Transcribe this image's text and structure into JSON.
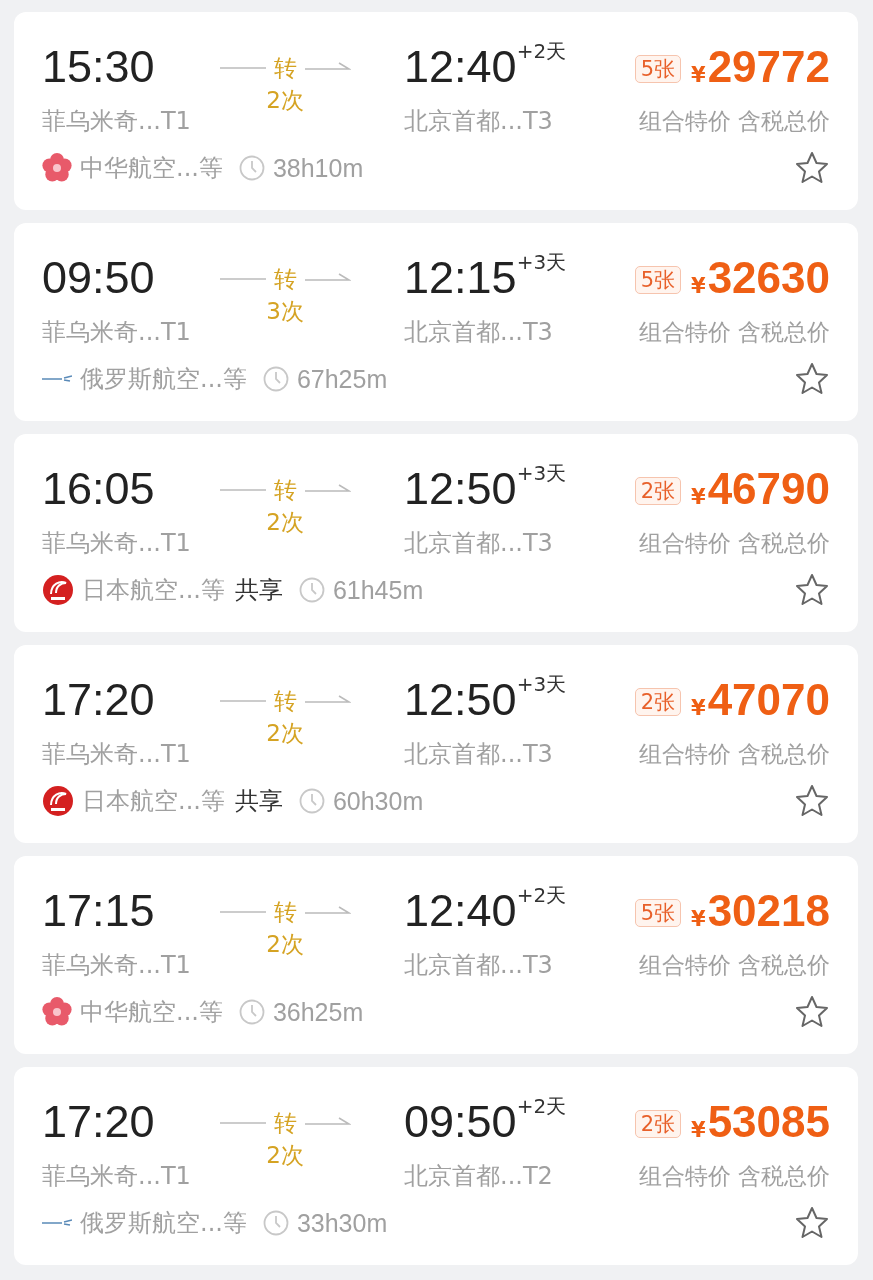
{
  "flights": [
    {
      "depart_time": "15:30",
      "depart_airport": "菲乌米奇...T1",
      "transfer": "转",
      "stops": "2次",
      "arrive_time": "12:40",
      "day_offset": "+2天",
      "arrive_airport": "北京首都...T3",
      "tickets": "5张",
      "currency": "¥",
      "price": "29772",
      "price_note": "组合特价 含税总价",
      "logo": {
        "kind": "plum"
      },
      "airline": "中华航空...等",
      "duration": "38h10m",
      "favorite": false
    },
    {
      "depart_time": "09:50",
      "depart_airport": "菲乌米奇...T1",
      "transfer": "转",
      "stops": "3次",
      "arrive_time": "12:15",
      "day_offset": "+3天",
      "arrive_airport": "北京首都...T3",
      "tickets": "5张",
      "currency": "¥",
      "price": "32630",
      "price_note": "组合特价 含税总价",
      "logo": {
        "kind": "wing"
      },
      "airline": "俄罗斯航空...等",
      "duration": "67h25m",
      "favorite": false
    },
    {
      "depart_time": "16:05",
      "depart_airport": "菲乌米奇...T1",
      "transfer": "转",
      "stops": "2次",
      "arrive_time": "12:50",
      "day_offset": "+3天",
      "arrive_airport": "北京首都...T3",
      "tickets": "2张",
      "currency": "¥",
      "price": "46790",
      "price_note": "组合特价 含税总价",
      "logo": {
        "kind": "crane"
      },
      "airline": "日本航空...等",
      "codeshare": "共享",
      "duration": "61h45m",
      "favorite": false
    },
    {
      "depart_time": "17:20",
      "depart_airport": "菲乌米奇...T1",
      "transfer": "转",
      "stops": "2次",
      "arrive_time": "12:50",
      "day_offset": "+3天",
      "arrive_airport": "北京首都...T3",
      "tickets": "2张",
      "currency": "¥",
      "price": "47070",
      "price_note": "组合特价 含税总价",
      "logo": {
        "kind": "crane"
      },
      "airline": "日本航空...等",
      "codeshare": "共享",
      "duration": "60h30m",
      "favorite": false
    },
    {
      "depart_time": "17:15",
      "depart_airport": "菲乌米奇...T1",
      "transfer": "转",
      "stops": "2次",
      "arrive_time": "12:40",
      "day_offset": "+2天",
      "arrive_airport": "北京首都...T3",
      "tickets": "5张",
      "currency": "¥",
      "price": "30218",
      "price_note": "组合特价 含税总价",
      "logo": {
        "kind": "plum"
      },
      "airline": "中华航空...等",
      "duration": "36h25m",
      "favorite": false
    },
    {
      "depart_time": "17:20",
      "depart_airport": "菲乌米奇...T1",
      "transfer": "转",
      "stops": "2次",
      "arrive_time": "09:50",
      "day_offset": "+2天",
      "arrive_airport": "北京首都...T2",
      "tickets": "2张",
      "currency": "¥",
      "price": "53085",
      "price_note": "组合特价 含税总价",
      "logo": {
        "kind": "wing"
      },
      "airline": "俄罗斯航空...等",
      "duration": "33h30m",
      "favorite": false
    }
  ]
}
